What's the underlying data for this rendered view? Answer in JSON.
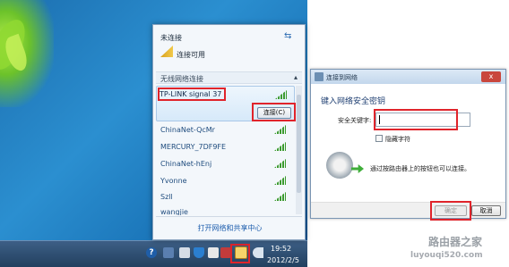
{
  "network_flyout": {
    "status": "未连接",
    "connections_available": "连接可用",
    "section_label": "无线网络连接",
    "selected_network": {
      "name": "TP-LINK signal 37",
      "connect_label": "连接(C)"
    },
    "networks": [
      {
        "name": "ChinaNet-QcMr"
      },
      {
        "name": "MERCURY_7DF9FE"
      },
      {
        "name": "ChinaNet-hEnj"
      },
      {
        "name": "Yvonne"
      },
      {
        "name": "Szll"
      },
      {
        "name": "wangjie"
      }
    ],
    "footer_link": "打开网络和共享中心"
  },
  "taskbar": {
    "clock_time": "19:52",
    "clock_date": "2012/2/5",
    "help_glyph": "?"
  },
  "dialog": {
    "title": "连接到网络",
    "heading": "键入网络安全密钥",
    "key_label": "安全关键字:",
    "key_value": "",
    "hide_chars_label": "隐藏字符",
    "wps_text": "通过按路由器上的按钮也可以连接。",
    "ok_label": "确定",
    "cancel_label": "取消",
    "close_glyph": "x"
  },
  "watermark": {
    "line1": "路由器之家",
    "line2": "luyouqi520.com"
  },
  "colors": {
    "highlight_border": "#e0242b",
    "link": "#1f5fae",
    "heading": "#1f3f72"
  }
}
